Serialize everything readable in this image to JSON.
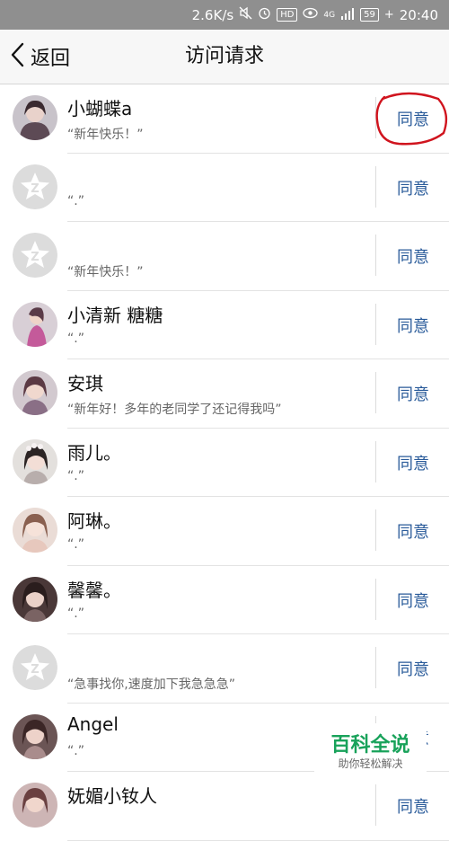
{
  "status_bar": {
    "network_speed": "2.6K/s",
    "mute_icon": "mute-icon",
    "alarm_icon": "alarm-icon",
    "hd_badge": "HD",
    "eye_icon": "eye-icon",
    "signal_label": "4G",
    "signal_icon": "signal-icon",
    "battery": "59",
    "charging_icon": "plus-icon",
    "time": "20:40"
  },
  "nav": {
    "back_label": "返回",
    "title": "访问请求"
  },
  "requests": [
    {
      "name": "小蝴蝶a",
      "message": "“新年快乐！”",
      "accept": "同意",
      "avatar": "photo"
    },
    {
      "name": "",
      "message": "“.”",
      "accept": "同意",
      "avatar": "default"
    },
    {
      "name": "",
      "message": "“新年快乐！”",
      "accept": "同意",
      "avatar": "default"
    },
    {
      "name": "小清新 糖糖",
      "message": "“.”",
      "accept": "同意",
      "avatar": "photo"
    },
    {
      "name": "安琪",
      "message": "“新年好！多年的老同学了还记得我吗”",
      "accept": "同意",
      "avatar": "photo"
    },
    {
      "name": "雨儿。",
      "message": "“.”",
      "accept": "同意",
      "avatar": "photo"
    },
    {
      "name": "阿琳。",
      "message": "“.”",
      "accept": "同意",
      "avatar": "photo"
    },
    {
      "name": "馨馨。",
      "message": "“.”",
      "accept": "同意",
      "avatar": "photo"
    },
    {
      "name": "",
      "message": "“急事找你,速度加下我急急急”",
      "accept": "同意",
      "avatar": "default"
    },
    {
      "name": "Angel",
      "message": "“.”",
      "accept": "同意",
      "avatar": "photo"
    },
    {
      "name": "妩媚小钕人",
      "message": "",
      "accept": "同意",
      "avatar": "photo"
    }
  ],
  "watermark": {
    "title": "百科全说",
    "subtitle": "助你轻松解决"
  },
  "colors": {
    "accent": "#2a5b9a",
    "status_bar": "#8f8f8f",
    "annotation": "#d0141e",
    "watermark_green": "#18a25a"
  }
}
